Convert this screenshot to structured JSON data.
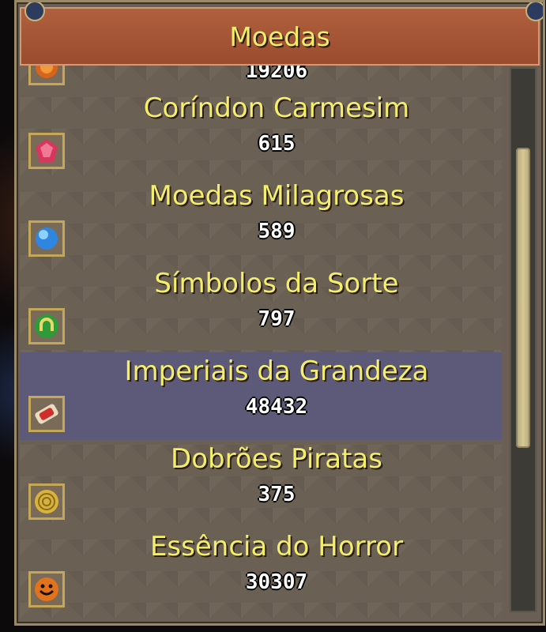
{
  "header": {
    "title": "Moedas"
  },
  "currencies": [
    {
      "name": "",
      "amount": "19206",
      "icon": "orange-coin-icon"
    },
    {
      "name": "Coríndon Carmesim",
      "amount": "615",
      "icon": "crimson-gem-icon"
    },
    {
      "name": "Moedas Milagrosas",
      "amount": "589",
      "icon": "blue-orb-icon"
    },
    {
      "name": "Símbolos da Sorte",
      "amount": "797",
      "icon": "green-horseshoe-icon"
    },
    {
      "name": "Imperiais da Grandeza",
      "amount": "48432",
      "icon": "red-ruby-icon"
    },
    {
      "name": "Dobrões Piratas",
      "amount": "375",
      "icon": "gold-spiral-coin-icon"
    },
    {
      "name": "Essência do Horror",
      "amount": "30307",
      "icon": "pumpkin-coin-icon"
    }
  ],
  "selected_index": 4,
  "colors": {
    "title": "#f3ef6a",
    "header_bg": "#a8573a",
    "selected_row": "#5c5a78",
    "panel_bg": "#6b6054"
  }
}
